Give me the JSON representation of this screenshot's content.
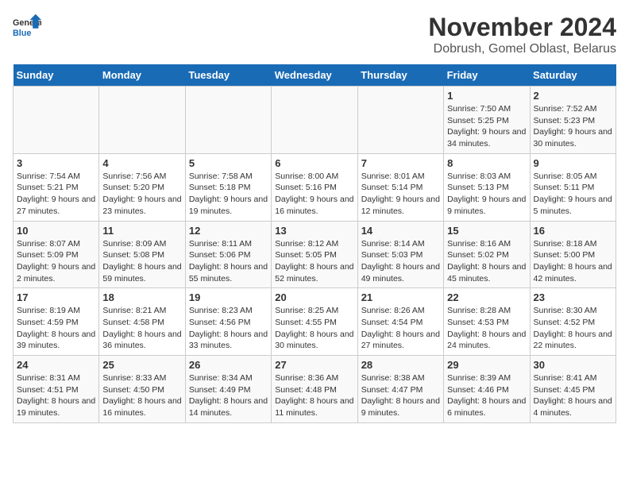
{
  "header": {
    "logo_line1": "General",
    "logo_line2": "Blue",
    "month": "November 2024",
    "location": "Dobrush, Gomel Oblast, Belarus"
  },
  "weekdays": [
    "Sunday",
    "Monday",
    "Tuesday",
    "Wednesday",
    "Thursday",
    "Friday",
    "Saturday"
  ],
  "weeks": [
    [
      {
        "day": "",
        "info": ""
      },
      {
        "day": "",
        "info": ""
      },
      {
        "day": "",
        "info": ""
      },
      {
        "day": "",
        "info": ""
      },
      {
        "day": "",
        "info": ""
      },
      {
        "day": "1",
        "info": "Sunrise: 7:50 AM\nSunset: 5:25 PM\nDaylight: 9 hours and 34 minutes."
      },
      {
        "day": "2",
        "info": "Sunrise: 7:52 AM\nSunset: 5:23 PM\nDaylight: 9 hours and 30 minutes."
      }
    ],
    [
      {
        "day": "3",
        "info": "Sunrise: 7:54 AM\nSunset: 5:21 PM\nDaylight: 9 hours and 27 minutes."
      },
      {
        "day": "4",
        "info": "Sunrise: 7:56 AM\nSunset: 5:20 PM\nDaylight: 9 hours and 23 minutes."
      },
      {
        "day": "5",
        "info": "Sunrise: 7:58 AM\nSunset: 5:18 PM\nDaylight: 9 hours and 19 minutes."
      },
      {
        "day": "6",
        "info": "Sunrise: 8:00 AM\nSunset: 5:16 PM\nDaylight: 9 hours and 16 minutes."
      },
      {
        "day": "7",
        "info": "Sunrise: 8:01 AM\nSunset: 5:14 PM\nDaylight: 9 hours and 12 minutes."
      },
      {
        "day": "8",
        "info": "Sunrise: 8:03 AM\nSunset: 5:13 PM\nDaylight: 9 hours and 9 minutes."
      },
      {
        "day": "9",
        "info": "Sunrise: 8:05 AM\nSunset: 5:11 PM\nDaylight: 9 hours and 5 minutes."
      }
    ],
    [
      {
        "day": "10",
        "info": "Sunrise: 8:07 AM\nSunset: 5:09 PM\nDaylight: 9 hours and 2 minutes."
      },
      {
        "day": "11",
        "info": "Sunrise: 8:09 AM\nSunset: 5:08 PM\nDaylight: 8 hours and 59 minutes."
      },
      {
        "day": "12",
        "info": "Sunrise: 8:11 AM\nSunset: 5:06 PM\nDaylight: 8 hours and 55 minutes."
      },
      {
        "day": "13",
        "info": "Sunrise: 8:12 AM\nSunset: 5:05 PM\nDaylight: 8 hours and 52 minutes."
      },
      {
        "day": "14",
        "info": "Sunrise: 8:14 AM\nSunset: 5:03 PM\nDaylight: 8 hours and 49 minutes."
      },
      {
        "day": "15",
        "info": "Sunrise: 8:16 AM\nSunset: 5:02 PM\nDaylight: 8 hours and 45 minutes."
      },
      {
        "day": "16",
        "info": "Sunrise: 8:18 AM\nSunset: 5:00 PM\nDaylight: 8 hours and 42 minutes."
      }
    ],
    [
      {
        "day": "17",
        "info": "Sunrise: 8:19 AM\nSunset: 4:59 PM\nDaylight: 8 hours and 39 minutes."
      },
      {
        "day": "18",
        "info": "Sunrise: 8:21 AM\nSunset: 4:58 PM\nDaylight: 8 hours and 36 minutes."
      },
      {
        "day": "19",
        "info": "Sunrise: 8:23 AM\nSunset: 4:56 PM\nDaylight: 8 hours and 33 minutes."
      },
      {
        "day": "20",
        "info": "Sunrise: 8:25 AM\nSunset: 4:55 PM\nDaylight: 8 hours and 30 minutes."
      },
      {
        "day": "21",
        "info": "Sunrise: 8:26 AM\nSunset: 4:54 PM\nDaylight: 8 hours and 27 minutes."
      },
      {
        "day": "22",
        "info": "Sunrise: 8:28 AM\nSunset: 4:53 PM\nDaylight: 8 hours and 24 minutes."
      },
      {
        "day": "23",
        "info": "Sunrise: 8:30 AM\nSunset: 4:52 PM\nDaylight: 8 hours and 22 minutes."
      }
    ],
    [
      {
        "day": "24",
        "info": "Sunrise: 8:31 AM\nSunset: 4:51 PM\nDaylight: 8 hours and 19 minutes."
      },
      {
        "day": "25",
        "info": "Sunrise: 8:33 AM\nSunset: 4:50 PM\nDaylight: 8 hours and 16 minutes."
      },
      {
        "day": "26",
        "info": "Sunrise: 8:34 AM\nSunset: 4:49 PM\nDaylight: 8 hours and 14 minutes."
      },
      {
        "day": "27",
        "info": "Sunrise: 8:36 AM\nSunset: 4:48 PM\nDaylight: 8 hours and 11 minutes."
      },
      {
        "day": "28",
        "info": "Sunrise: 8:38 AM\nSunset: 4:47 PM\nDaylight: 8 hours and 9 minutes."
      },
      {
        "day": "29",
        "info": "Sunrise: 8:39 AM\nSunset: 4:46 PM\nDaylight: 8 hours and 6 minutes."
      },
      {
        "day": "30",
        "info": "Sunrise: 8:41 AM\nSunset: 4:45 PM\nDaylight: 8 hours and 4 minutes."
      }
    ]
  ]
}
